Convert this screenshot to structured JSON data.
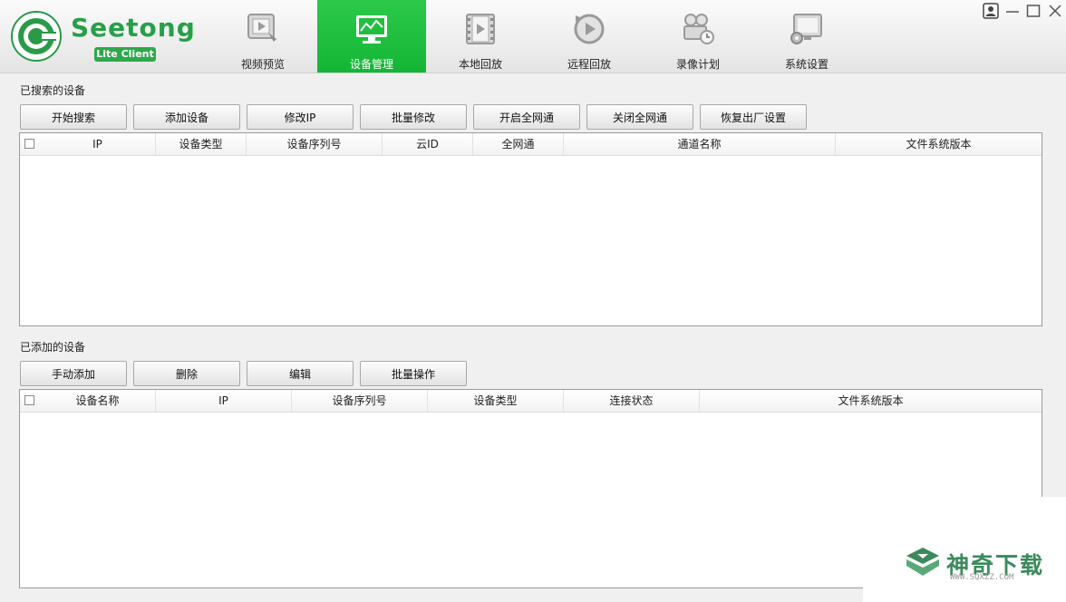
{
  "app": {
    "logo_word": "Seetong",
    "logo_badge": "Lite Client"
  },
  "nav": {
    "tabs": [
      {
        "label": "视频预览",
        "icon": "video-preview-icon"
      },
      {
        "label": "设备管理",
        "icon": "device-manage-icon",
        "active": true
      },
      {
        "label": "本地回放",
        "icon": "film-icon"
      },
      {
        "label": "远程回放",
        "icon": "replay-icon"
      },
      {
        "label": "录像计划",
        "icon": "camera-schedule-icon"
      },
      {
        "label": "系统设置",
        "icon": "monitor-gear-icon"
      }
    ]
  },
  "window": {
    "controls": [
      "user-icon",
      "minimize-icon",
      "maximize-icon",
      "close-icon"
    ]
  },
  "searched": {
    "label": "已搜索的设备",
    "buttons": [
      "开始搜索",
      "添加设备",
      "修改IP",
      "批量修改",
      "开启全网通",
      "关闭全网通",
      "恢复出厂设置"
    ],
    "columns": [
      "IP",
      "设备类型",
      "设备序列号",
      "云ID",
      "全网通",
      "通道名称",
      "文件系统版本"
    ],
    "rows": []
  },
  "added": {
    "label": "已添加的设备",
    "buttons": [
      "手动添加",
      "删除",
      "编辑",
      "批量操作"
    ],
    "columns": [
      "设备名称",
      "IP",
      "设备序列号",
      "设备类型",
      "连接状态",
      "文件系统版本"
    ],
    "rows": []
  },
  "watermark": {
    "text": "神奇下载",
    "url": "WWW.SQXZZ.COM"
  },
  "colors": {
    "brand_green": "#26a048",
    "active_tab": "#1fbf3f"
  }
}
